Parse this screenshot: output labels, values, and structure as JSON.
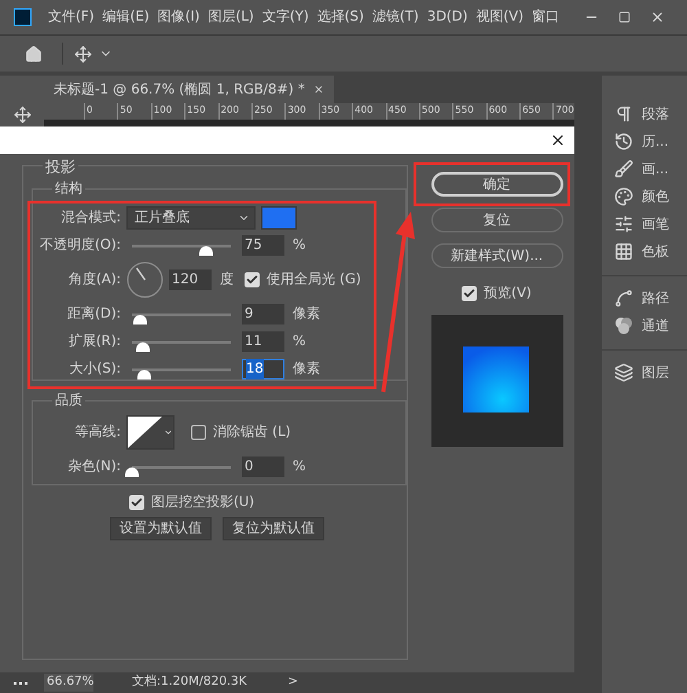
{
  "menu_bar": {
    "items": [
      "文件(F)",
      "编辑(E)",
      "图像(I)",
      "图层(L)",
      "文字(Y)",
      "选择(S)",
      "滤镜(T)",
      "3D(D)",
      "视图(V)",
      "窗口"
    ]
  },
  "document_tab": {
    "title": "未标题-1 @ 66.7% (椭圆 1, RGB/8#) *"
  },
  "ruler": {
    "ticks": [
      "0",
      "50",
      "100",
      "150",
      "200",
      "250",
      "300",
      "350",
      "400",
      "450",
      "500",
      "550",
      "600",
      "650",
      "700"
    ]
  },
  "panels": [
    {
      "label": "段落",
      "kind": "paragraph"
    },
    {
      "label": "历...",
      "kind": "history"
    },
    {
      "label": "画...",
      "kind": "brush_settings"
    },
    {
      "label": "颜色",
      "kind": "color"
    },
    {
      "label": "画笔",
      "kind": "brushes"
    },
    {
      "label": "色板",
      "kind": "swatches"
    },
    {
      "label": "路径",
      "kind": "paths"
    },
    {
      "label": "通道",
      "kind": "channels"
    },
    {
      "label": "图层",
      "kind": "layers"
    }
  ],
  "dialog": {
    "section_title": "投影",
    "structure": {
      "title": "结构",
      "blend_mode": {
        "label": "混合模式:",
        "value": "正片叠底",
        "color": "#1f6ff2"
      },
      "rows": [
        {
          "kind": "slider",
          "label": "不透明度(O):",
          "level": 0.75,
          "value": "75",
          "unit": "%",
          "selected": false
        },
        {
          "kind": "angle",
          "label": "角度(A):",
          "value": "120",
          "unit": "度",
          "global_light": {
            "label": "使用全局光 (G)",
            "checked": true
          }
        },
        {
          "kind": "slider",
          "label": "距离(D):",
          "level": 0.08,
          "value": "9",
          "unit": "像素",
          "selected": false
        },
        {
          "kind": "slider",
          "label": "扩展(R):",
          "level": 0.11,
          "value": "11",
          "unit": "%",
          "selected": false
        },
        {
          "kind": "slider",
          "label": "大小(S):",
          "level": 0.13,
          "value": "18",
          "unit": "像素",
          "selected": true
        }
      ]
    },
    "quality": {
      "title": "品质",
      "contour_label": "等高线:",
      "anti_alias": {
        "label": "消除锯齿 (L)",
        "checked": false
      },
      "noise": {
        "label": "杂色(N):",
        "level": 0,
        "value": "0",
        "unit": "%"
      }
    },
    "knockout": {
      "label": "图层挖空投影(U)",
      "checked": true
    },
    "default_buttons": [
      "设置为默认值",
      "复位为默认值"
    ],
    "side_buttons": [
      {
        "label": "确定",
        "default": true
      },
      {
        "label": "复位",
        "default": false
      },
      {
        "label": "新建样式(W)...",
        "default": false
      }
    ],
    "preview": {
      "label": "预览(V)",
      "checked": true
    }
  },
  "status_bar": {
    "zoom": "66.67%",
    "document": "文档:1.20M/820.3K",
    "arrow": ">"
  }
}
